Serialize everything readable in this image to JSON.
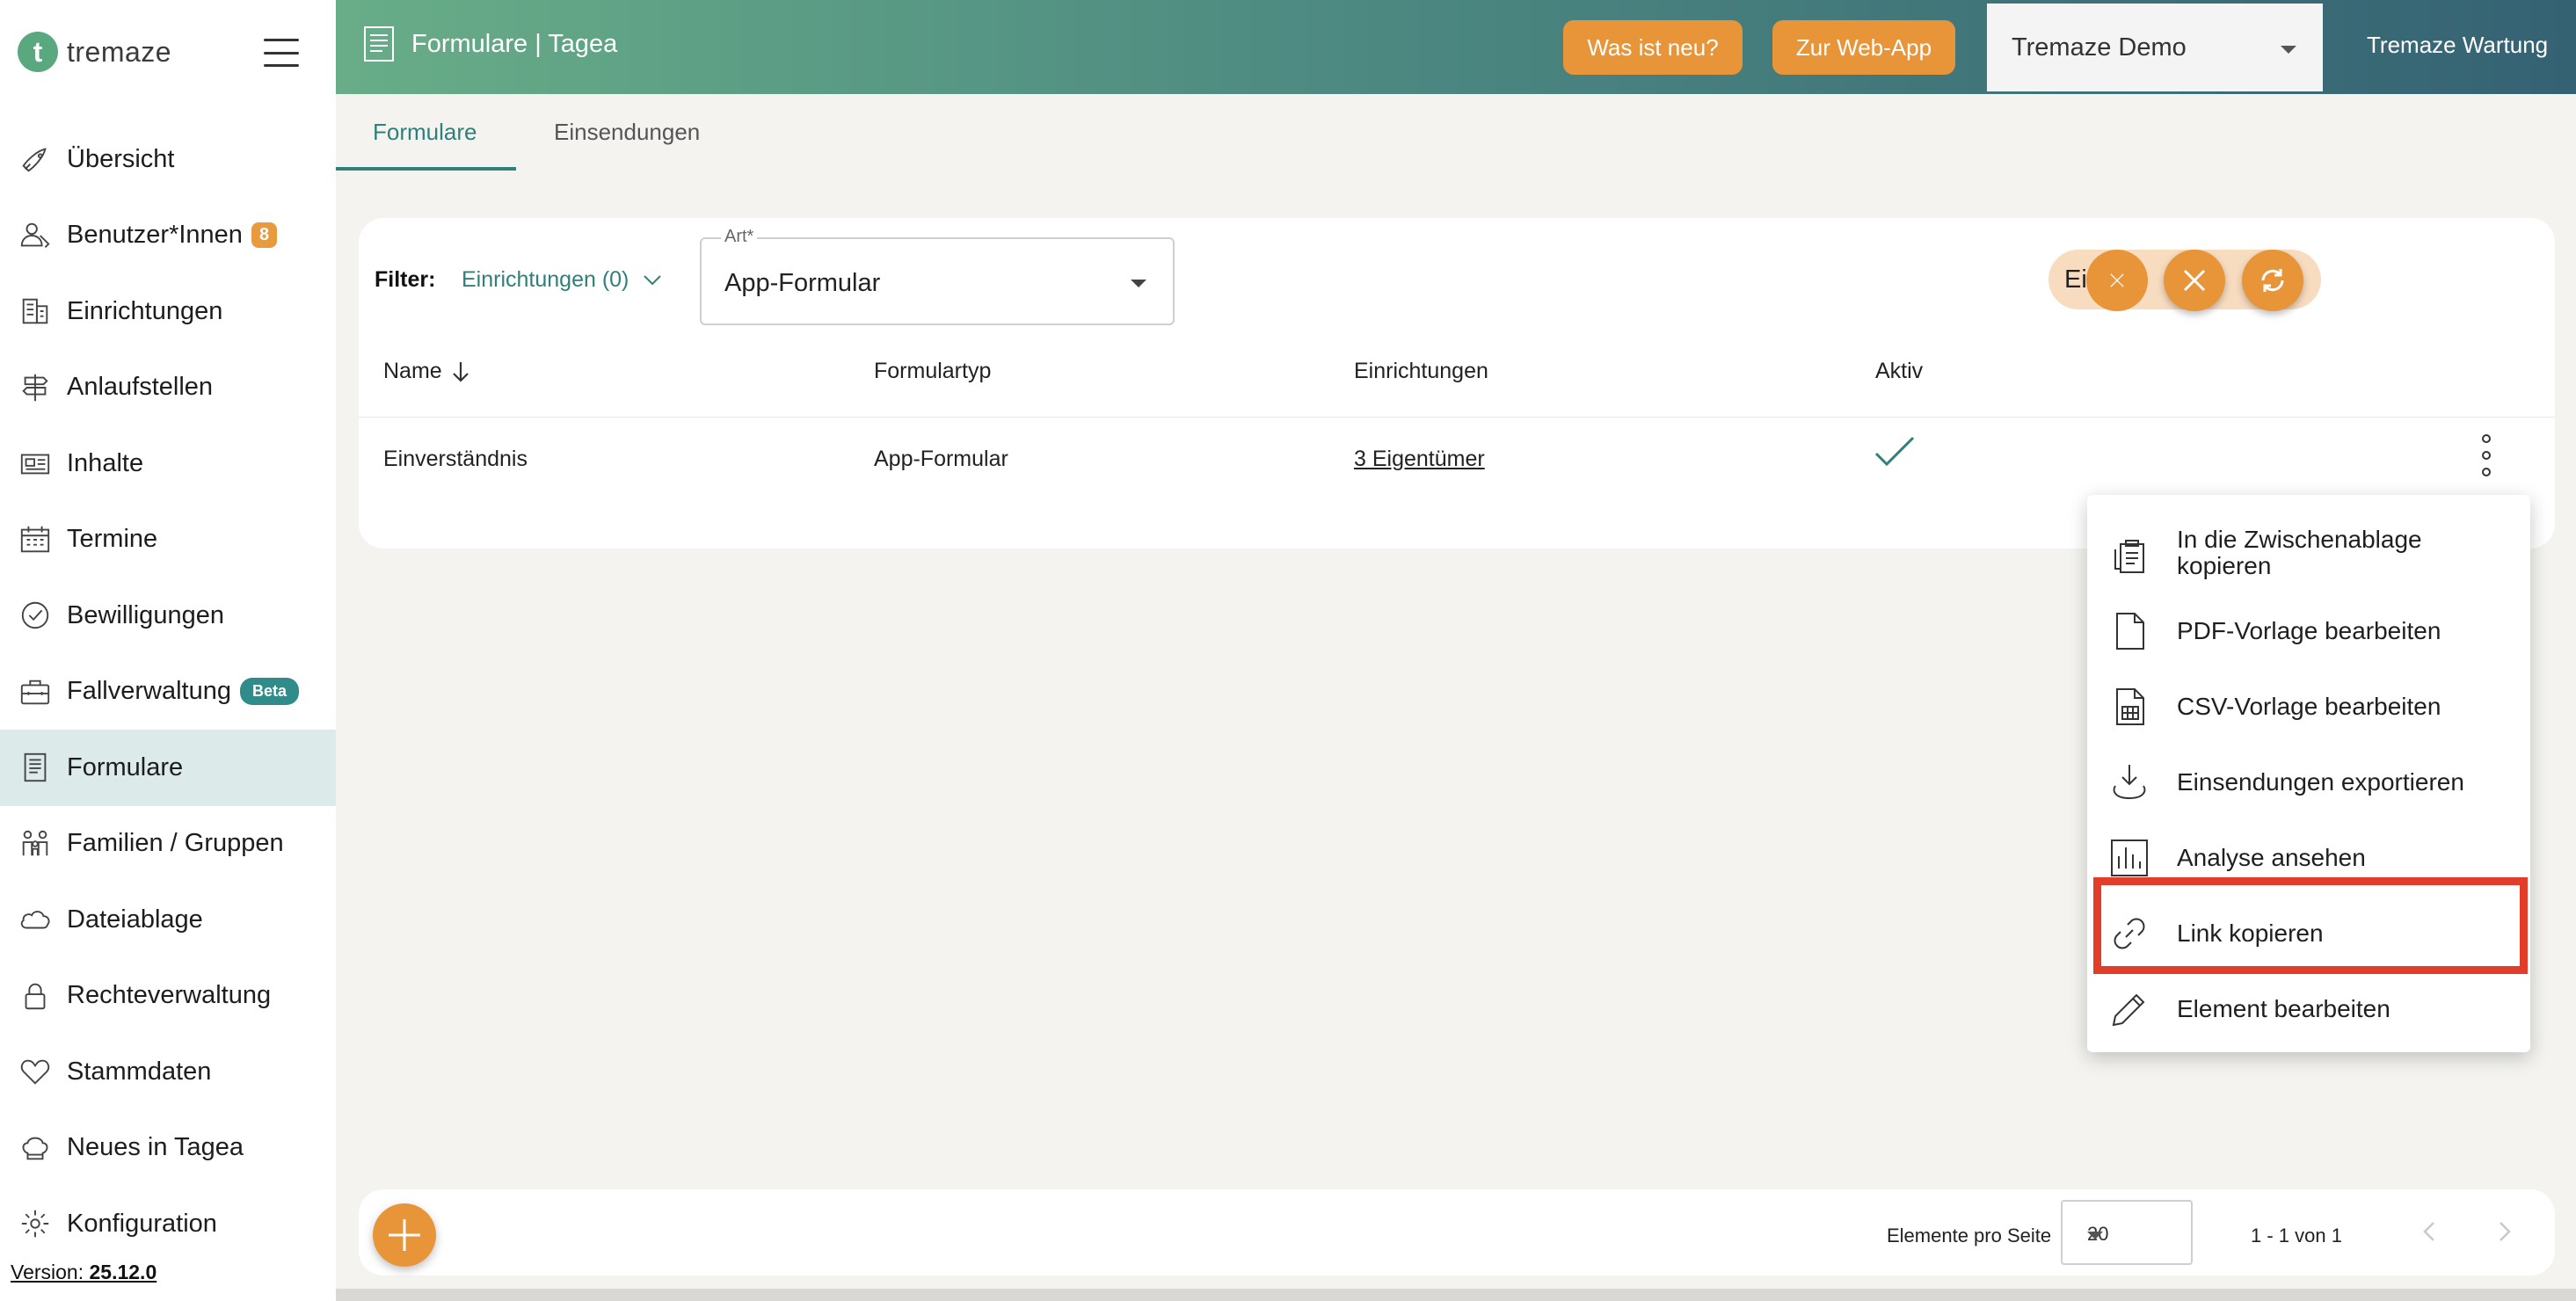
{
  "app": {
    "logo_letter": "t",
    "logo_text": "tremaze",
    "brand_color": "#5aa880",
    "accent_color": "#e8953a",
    "primary_color": "#2f7f7a"
  },
  "sidebar": {
    "items": [
      {
        "label": "Übersicht",
        "icon": "rocket-icon"
      },
      {
        "label": "Benutzer*Innen",
        "icon": "users-icon",
        "badge": "8"
      },
      {
        "label": "Einrichtungen",
        "icon": "building-icon"
      },
      {
        "label": "Anlaufstellen",
        "icon": "signpost-icon"
      },
      {
        "label": "Inhalte",
        "icon": "newspaper-icon"
      },
      {
        "label": "Termine",
        "icon": "calendar-icon"
      },
      {
        "label": "Bewilligungen",
        "icon": "check-circle-icon"
      },
      {
        "label": "Fallverwaltung",
        "icon": "briefcase-icon",
        "badge": "Beta"
      },
      {
        "label": "Formulare",
        "icon": "form-icon",
        "active": true
      },
      {
        "label": "Familien / Gruppen",
        "icon": "family-icon"
      },
      {
        "label": "Dateiablage",
        "icon": "cloud-icon"
      },
      {
        "label": "Rechteverwaltung",
        "icon": "lock-icon"
      },
      {
        "label": "Stammdaten",
        "icon": "heart-icon"
      },
      {
        "label": "Neues in Tagea",
        "icon": "chef-hat-icon"
      },
      {
        "label": "Konfiguration",
        "icon": "gear-icon"
      }
    ],
    "version_label": "Version: ",
    "version_number": "25.12.0"
  },
  "header": {
    "title": "Formulare | Tagea",
    "whats_new": "Was ist neu?",
    "web_app": "Zur Web-App",
    "tenant": "Tremaze Demo",
    "user": "Tremaze Wartung"
  },
  "tabs": [
    {
      "label": "Formulare",
      "active": true
    },
    {
      "label": "Einsendungen"
    }
  ],
  "filter": {
    "label": "Filter:",
    "value": "Einrichtungen (0)",
    "art_label": "Art*",
    "art_value": "App-Formular"
  },
  "search": {
    "value": "Einv"
  },
  "table": {
    "columns": [
      "Name",
      "Formulartyp",
      "Einrichtungen",
      "Aktiv"
    ],
    "rows": [
      {
        "name": "Einverständnis",
        "type": "App-Formular",
        "facilities": "3 Eigentümer",
        "active": true
      }
    ]
  },
  "menu": {
    "items": [
      {
        "label": "In die Zwischenablage kopieren",
        "icon": "clipboard-icon"
      },
      {
        "label": "PDF-Vorlage bearbeiten",
        "icon": "document-icon"
      },
      {
        "label": "CSV-Vorlage bearbeiten",
        "icon": "spreadsheet-icon"
      },
      {
        "label": "Einsendungen exportieren",
        "icon": "download-icon"
      },
      {
        "label": "Analyse ansehen",
        "icon": "chart-icon"
      },
      {
        "label": "Link kopieren",
        "icon": "link-icon",
        "highlighted": true
      },
      {
        "label": "Element bearbeiten",
        "icon": "pencil-icon"
      }
    ],
    "highlight_color": "#e23d28"
  },
  "footer": {
    "per_page_label": "Elemente pro Seite",
    "per_page_value": "20",
    "range": "1 - 1 von 1"
  }
}
